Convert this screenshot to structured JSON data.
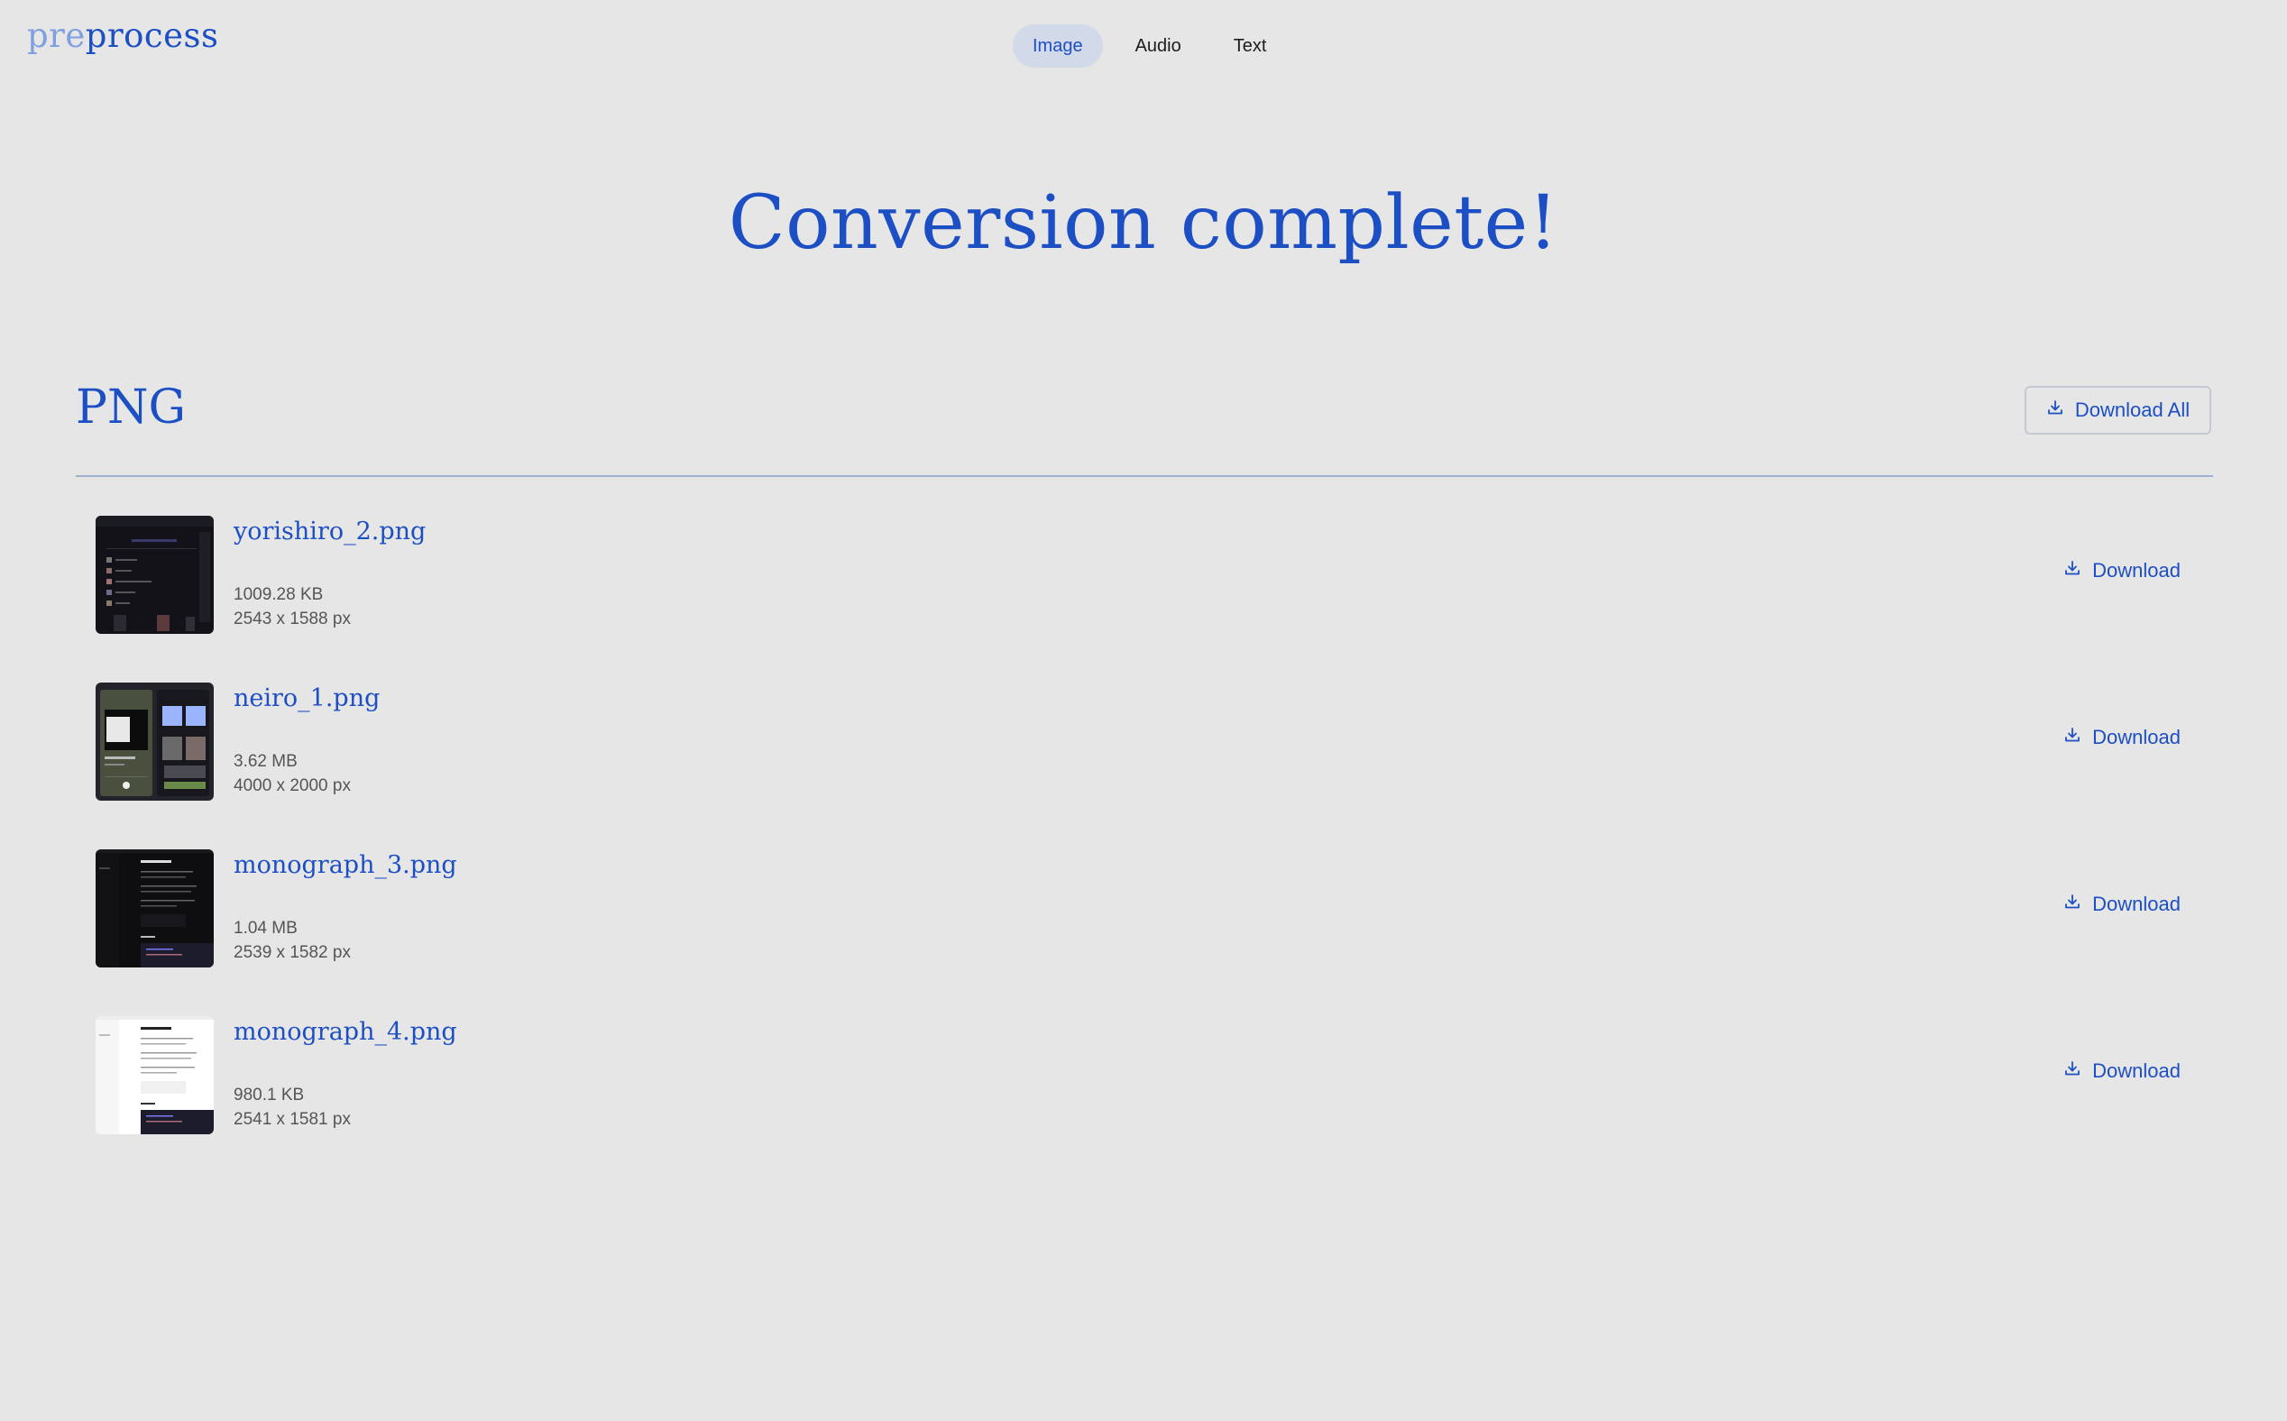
{
  "logo": {
    "part1": "pre",
    "part2": "process"
  },
  "nav": {
    "tabs": [
      "Image",
      "Audio",
      "Text"
    ],
    "active": "Image"
  },
  "headline": "Conversion complete!",
  "section": {
    "title": "PNG",
    "download_all_label": "Download All"
  },
  "files": [
    {
      "name": "yorishiro_2.png",
      "size": "1009.28 KB",
      "dimensions": "2543 x 1588 px",
      "download_label": "Download"
    },
    {
      "name": "neiro_1.png",
      "size": "3.62 MB",
      "dimensions": "4000 x 2000 px",
      "download_label": "Download"
    },
    {
      "name": "monograph_3.png",
      "size": "1.04 MB",
      "dimensions": "2539 x 1582 px",
      "download_label": "Download"
    },
    {
      "name": "monograph_4.png",
      "size": "980.1 KB",
      "dimensions": "2541 x 1581 px",
      "download_label": "Download"
    }
  ],
  "colors": {
    "accent": "#1d4fc4",
    "background": "#e6e6e6",
    "active_tab_bg": "#d2d9e8"
  },
  "icons": {
    "download": "download-icon"
  }
}
